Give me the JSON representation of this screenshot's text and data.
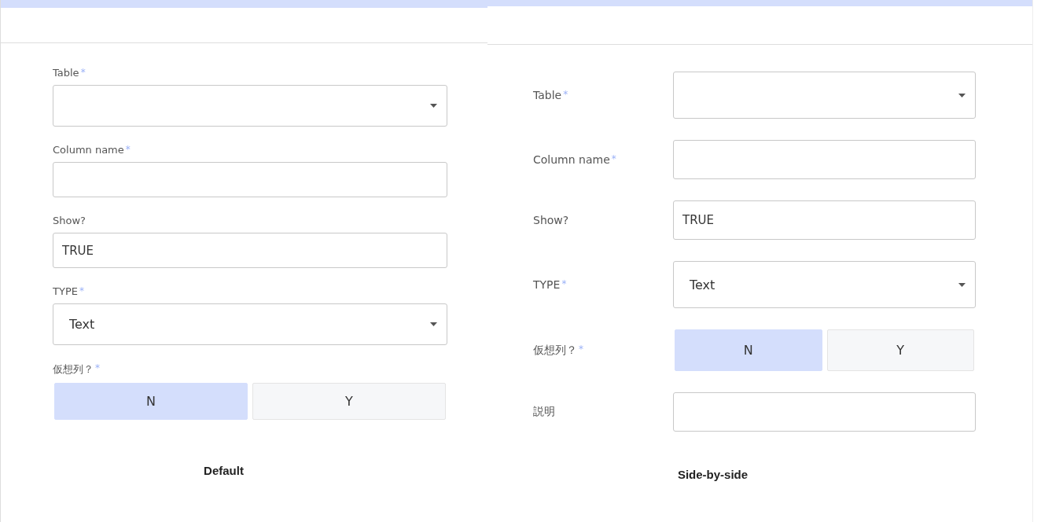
{
  "panels": [
    {
      "kind": "stacked",
      "caption": "Default",
      "fields": [
        {
          "kind": "select",
          "label": "Table",
          "required_mark": "*"
        },
        {
          "kind": "text",
          "label": "Column name",
          "required_mark": "*"
        },
        {
          "kind": "text",
          "label": "Show?",
          "value": "TRUE"
        },
        {
          "kind": "select",
          "label": "TYPE",
          "required_mark": "*",
          "value": "Text"
        },
        {
          "kind": "toggle",
          "label": "仮想列？",
          "required_mark": "*",
          "options": [
            {
              "label": "N",
              "selected": true
            },
            {
              "label": "Y",
              "selected": false
            }
          ]
        }
      ]
    },
    {
      "kind": "side",
      "caption": "Side-by-side",
      "fields": [
        {
          "kind": "select",
          "label": "Table",
          "required_mark": "*"
        },
        {
          "kind": "text",
          "label": "Column name",
          "required_mark": "*"
        },
        {
          "kind": "text",
          "label": "Show?",
          "value": "TRUE"
        },
        {
          "kind": "select",
          "label": "TYPE",
          "required_mark": "*",
          "value": "Text"
        },
        {
          "kind": "toggle",
          "label": "仮想列？",
          "required_mark": "*",
          "options": [
            {
              "label": "N",
              "selected": true
            },
            {
              "label": "Y",
              "selected": false
            }
          ]
        },
        {
          "kind": "text",
          "label": "説明"
        }
      ]
    }
  ]
}
